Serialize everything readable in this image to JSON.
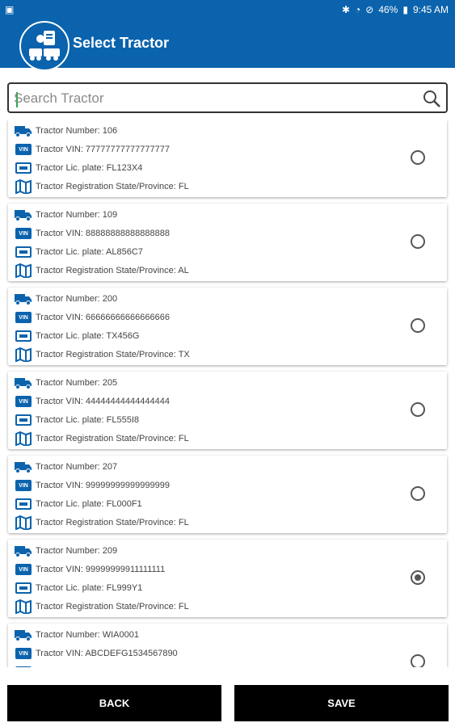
{
  "status_bar": {
    "battery": "46%",
    "time": "9:45 AM"
  },
  "header": {
    "title": "Select Tractor"
  },
  "search": {
    "placeholder": "Search Tractor",
    "value": ""
  },
  "tractors": [
    {
      "number": "Tractor Number: 106",
      "vin": "Tractor VIN: 77777777777777777",
      "plate": "Tractor Lic. plate: FL123X4",
      "state": "Tractor Registration State/Province: FL",
      "selected": false
    },
    {
      "number": "Tractor Number: 109",
      "vin": "Tractor VIN: 88888888888888888",
      "plate": "Tractor Lic. plate: AL856C7",
      "state": "Tractor Registration State/Province: AL",
      "selected": false
    },
    {
      "number": "Tractor Number: 200",
      "vin": "Tractor VIN: 66666666666666666",
      "plate": "Tractor Lic. plate: TX456G",
      "state": "Tractor Registration State/Province: TX",
      "selected": false
    },
    {
      "number": "Tractor Number: 205",
      "vin": "Tractor VIN: 44444444444444444",
      "plate": "Tractor Lic. plate: FL555I8",
      "state": "Tractor Registration State/Province: FL",
      "selected": false
    },
    {
      "number": "Tractor Number: 207",
      "vin": "Tractor VIN: 99999999999999999",
      "plate": "Tractor Lic. plate: FL000F1",
      "state": "Tractor Registration State/Province: FL",
      "selected": false
    },
    {
      "number": "Tractor Number: 209",
      "vin": "Tractor VIN: 99999999911111111",
      "plate": "Tractor Lic. plate: FL999Y1",
      "state": "Tractor Registration State/Province: FL",
      "selected": true
    },
    {
      "number": "Tractor Number: WIA0001",
      "vin": "Tractor VIN: ABCDEFG1534567890",
      "plate": "",
      "state": "",
      "selected": false
    }
  ],
  "badges": {
    "vin": "VIN"
  },
  "buttons": {
    "back": "BACK",
    "save": "SAVE"
  },
  "colors": {
    "brand": "#0b63ad",
    "button": "#000000"
  },
  "icons": {
    "truck": "truck-icon",
    "vin": "vin-badge-icon",
    "plate": "license-plate-icon",
    "map": "map-icon",
    "search": "search-icon"
  }
}
